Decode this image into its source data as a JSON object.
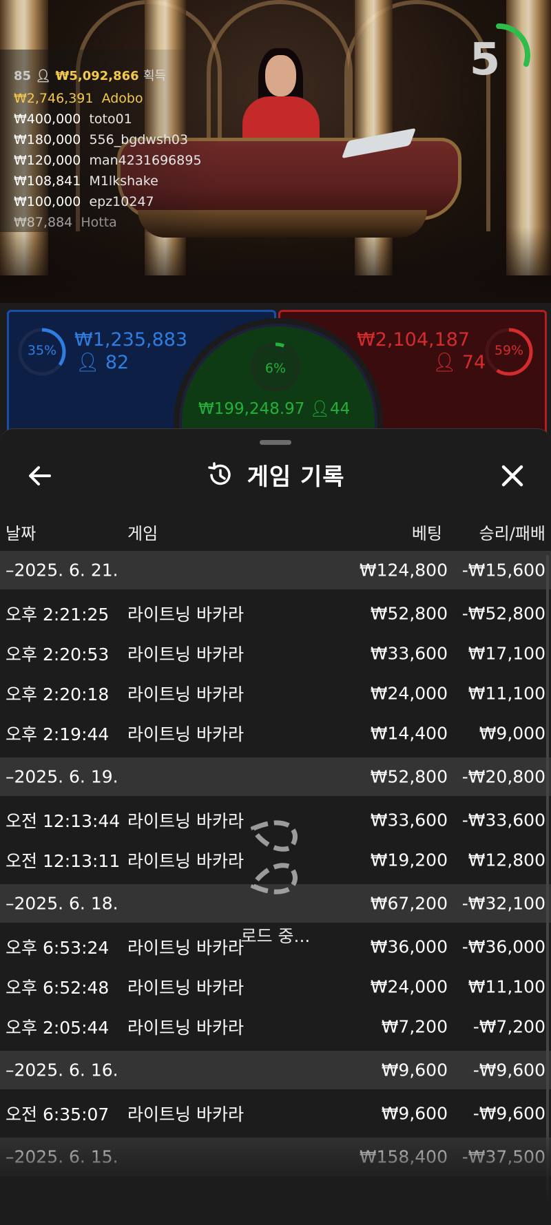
{
  "leaderboard": {
    "winners_count": "85",
    "total": "₩5,092,866",
    "gain_label": "획득",
    "entries": [
      {
        "amount": "₩2,746,391",
        "name": "Adobo"
      },
      {
        "amount": "₩400,000",
        "name": "toto01"
      },
      {
        "amount": "₩180,000",
        "name": "556_bgdwsh03"
      },
      {
        "amount": "₩120,000",
        "name": "man4231696895"
      },
      {
        "amount": "₩108,841",
        "name": "M1lkshake"
      },
      {
        "amount": "₩100,000",
        "name": "epz10247"
      },
      {
        "amount": "₩87,884",
        "name": "Hotta"
      }
    ]
  },
  "countdown": {
    "value": "5",
    "progress": 0.3
  },
  "bets": {
    "player": {
      "percent": "35%",
      "percent_value": 0.35,
      "amount": "₩1,235,883",
      "players": "82",
      "color": "#2f7de0"
    },
    "banker": {
      "percent": "59%",
      "percent_value": 0.59,
      "amount": "₩2,104,187",
      "players": "74",
      "color": "#d42c2c"
    },
    "tie": {
      "percent": "6%",
      "percent_value": 0.06,
      "amount": "₩199,248.97",
      "players": "44",
      "color": "#22b13a"
    }
  },
  "sheet": {
    "title": "게임 기록",
    "icons": {
      "back": "arrow-left-icon",
      "title": "history-icon",
      "close": "close-icon"
    },
    "columns": {
      "date": "날짜",
      "game": "게임",
      "bet": "베팅",
      "result": "승리/패배"
    },
    "days": [
      {
        "date": "–2025. 6. 21.",
        "bet": "₩124,800",
        "result": "-₩15,600",
        "rows": [
          {
            "time": "오후 2:21:25",
            "game": "라이트닝 바카라",
            "bet": "₩52,800",
            "result": "-₩52,800"
          },
          {
            "time": "오후 2:20:53",
            "game": "라이트닝 바카라",
            "bet": "₩33,600",
            "result": "₩17,100"
          },
          {
            "time": "오후 2:20:18",
            "game": "라이트닝 바카라",
            "bet": "₩24,000",
            "result": "₩11,100"
          },
          {
            "time": "오후 2:19:44",
            "game": "라이트닝 바카라",
            "bet": "₩14,400",
            "result": "₩9,000"
          }
        ]
      },
      {
        "date": "–2025. 6. 19.",
        "bet": "₩52,800",
        "result": "-₩20,800",
        "rows": [
          {
            "time": "오전 12:13:44",
            "game": "라이트닝 바카라",
            "bet": "₩33,600",
            "result": "-₩33,600"
          },
          {
            "time": "오전 12:13:11",
            "game": "라이트닝 바카라",
            "bet": "₩19,200",
            "result": "₩12,800"
          }
        ]
      },
      {
        "date": "–2025. 6. 18.",
        "bet": "₩67,200",
        "result": "-₩32,100",
        "rows": [
          {
            "time": "오후 6:53:24",
            "game": "라이트닝 바카라",
            "bet": "₩36,000",
            "result": "-₩36,000"
          },
          {
            "time": "오후 6:52:48",
            "game": "라이트닝 바카라",
            "bet": "₩24,000",
            "result": "₩11,100"
          },
          {
            "time": "오후 2:05:44",
            "game": "라이트닝 바카라",
            "bet": "₩7,200",
            "result": "-₩7,200"
          }
        ]
      },
      {
        "date": "–2025. 6. 16.",
        "bet": "₩9,600",
        "result": "-₩9,600",
        "rows": [
          {
            "time": "오전 6:35:07",
            "game": "라이트닝 바카라",
            "bet": "₩9,600",
            "result": "-₩9,600"
          }
        ]
      },
      {
        "date": "–2025. 6. 15.",
        "bet": "₩158,400",
        "result": "-₩37,500",
        "rows": []
      }
    ]
  },
  "loading": {
    "label": "로드 중...",
    "icon": "spinner-icon"
  }
}
